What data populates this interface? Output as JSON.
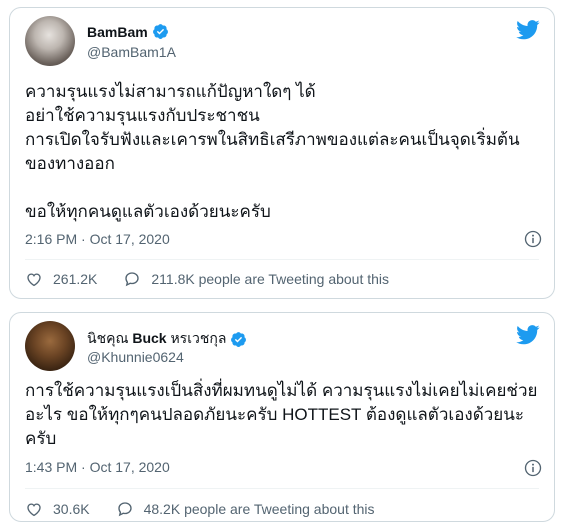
{
  "tweets": [
    {
      "display_name": "BamBam",
      "handle": "@BamBam1A",
      "text": "ความรุนแรงไม่สามารถแก้ปัญหาใดๆ ได้\nอย่าใช้ความรุนแรงกับประชาชน\nการเปิดใจรับฟังและเคารพในสิทธิเสรีภาพของแต่ละคนเป็นจุดเริ่มต้นของทางออก\n\nขอให้ทุกคนดูแลตัวเองด้วยนะครับ",
      "timestamp": "2:16 PM · Oct 17, 2020",
      "likes": "261.2K",
      "tweeting": "211.8K people are Tweeting about this"
    },
    {
      "display_name_pre": "นิชคุณ ",
      "display_name_bold": "Buck",
      "display_name_post": " หรเวชกุล",
      "handle": "@Khunnie0624",
      "text": "การใช้ความรุนแรงเป็นสิ่งที่ผมทนดูไม่ได้ ความรุนแรงไม่เคยไม่เคยช่วยอะไร ขอให้ทุกๆคนปลอดภัยนะครับ HOTTEST ต้องดูแลตัวเองด้วยนะครับ",
      "timestamp": "1:43 PM · Oct 17, 2020",
      "likes": "30.6K",
      "tweeting": "48.2K people are Tweeting about this"
    }
  ],
  "icons": {
    "brand": "twitter-bird-icon",
    "verified": "verified-badge-icon",
    "info": "info-icon",
    "like": "heart-icon",
    "reply": "speech-bubble-icon"
  },
  "colors": {
    "brand": "#1d9bf0",
    "text": "#0f1419",
    "muted": "#536471",
    "border": "#cfd9de"
  }
}
